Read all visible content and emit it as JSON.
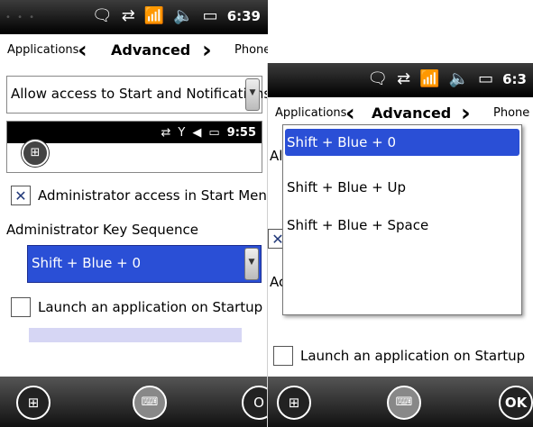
{
  "left_screen": {
    "statusbar": {
      "time": "6:39",
      "icons": [
        "message-icon",
        "sync-icon",
        "signal-icon",
        "speaker-icon",
        "battery-icon"
      ]
    },
    "navbar": {
      "left": "Applications",
      "title": "Advanced",
      "right": "Phone"
    },
    "start_access_combo": "Allow access to Start and Notifications",
    "mini_status_time": "9:55",
    "admin_checkbox": {
      "label": "Administrator access in Start Menu",
      "checked": true,
      "check_mark": "✕"
    },
    "key_sequence_label": "Administrator Key Sequence",
    "key_sequence_combo": "Shift + Blue + 0",
    "launch_checkbox": {
      "label": "Launch an application on Startup",
      "checked": false
    },
    "bottom_right_button": "O"
  },
  "right_screen": {
    "statusbar": {
      "time": "6:3",
      "icons": [
        "message-icon",
        "sync-icon",
        "signal-icon",
        "speaker-icon",
        "battery-icon"
      ]
    },
    "navbar": {
      "left": "Applications",
      "title": "Advanced",
      "right": "Phone"
    },
    "partial_texts": {
      "start_access": "Al",
      "key_sequence_label": "Ac",
      "admin_check": "✕"
    },
    "dropdown_options": [
      "Shift + Blue + 0",
      "Shift + Blue + Up",
      "Shift + Blue + Space"
    ],
    "selected_option_index": 0,
    "launch_checkbox": {
      "label": "Launch an application on Startup",
      "checked": false
    },
    "ok_button": "OK"
  }
}
